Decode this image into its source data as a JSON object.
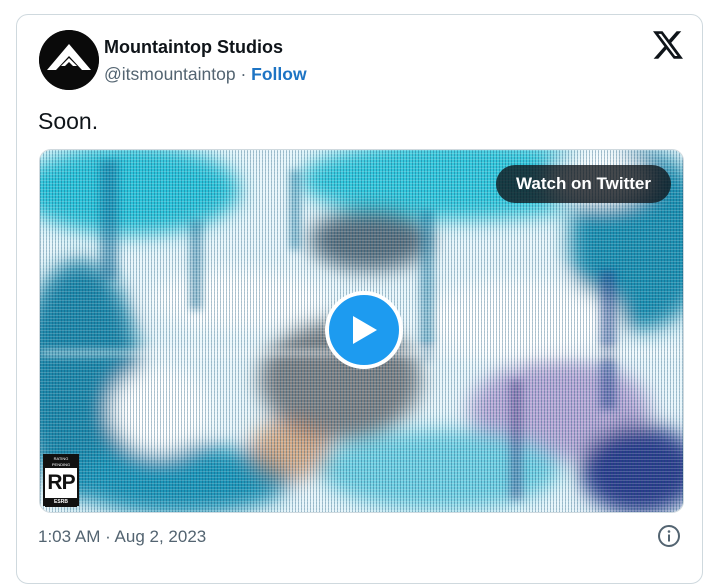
{
  "tweet": {
    "author_name": "Mountaintop Studios",
    "handle": "@itsmountaintop",
    "separator": "·",
    "follow_label": "Follow",
    "text": "Soon.",
    "timestamp": "1:03 AM · Aug 2, 2023"
  },
  "media": {
    "watch_label": "Watch on Twitter",
    "rating_badge": {
      "top": "RATING PENDING",
      "code": "RP",
      "bottom": "ESRB"
    }
  },
  "icons": {
    "platform": "x-logo-icon",
    "play": "play-icon",
    "info": "info-icon",
    "avatar": "mountain-logo-icon"
  },
  "colors": {
    "accent": "#1d9bf0",
    "follow": "#1d74c4",
    "secondary_text": "#536471",
    "border": "#cfd9de"
  }
}
